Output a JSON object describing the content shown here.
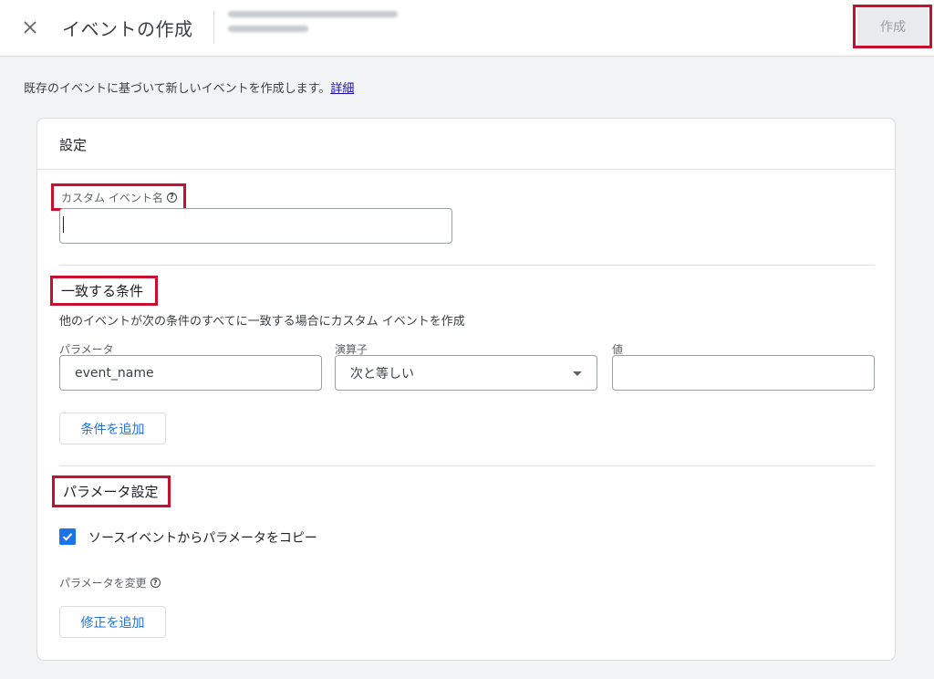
{
  "header": {
    "close_glyph": "✕",
    "title": "イベントの作成",
    "create_label": "作成"
  },
  "intro": {
    "text": "既存のイベントに基づいて新しいイベントを作成します。",
    "link": "詳細"
  },
  "card": {
    "title": "設定",
    "custom_event": {
      "label": "カスタム イベント名",
      "value": ""
    },
    "conditions": {
      "title": "一致する条件",
      "description": "他のイベントが次の条件のすべてに一致する場合にカスタム イベントを作成",
      "columns": [
        "パラメータ",
        "演算子",
        "値"
      ],
      "parameter_value": "event_name",
      "operator_value": "次と等しい",
      "value_value": "",
      "add_condition_label": "条件を追加"
    },
    "params": {
      "title": "パラメータ設定",
      "copy_label": "ソースイベントからパラメータをコピー",
      "copy_checked": true,
      "modify_label": "パラメータを変更",
      "add_modification_label": "修正を追加"
    }
  },
  "colors": {
    "accent": "#1a73e8",
    "highlight": "#c8102e",
    "background": "#f1f3f4"
  }
}
